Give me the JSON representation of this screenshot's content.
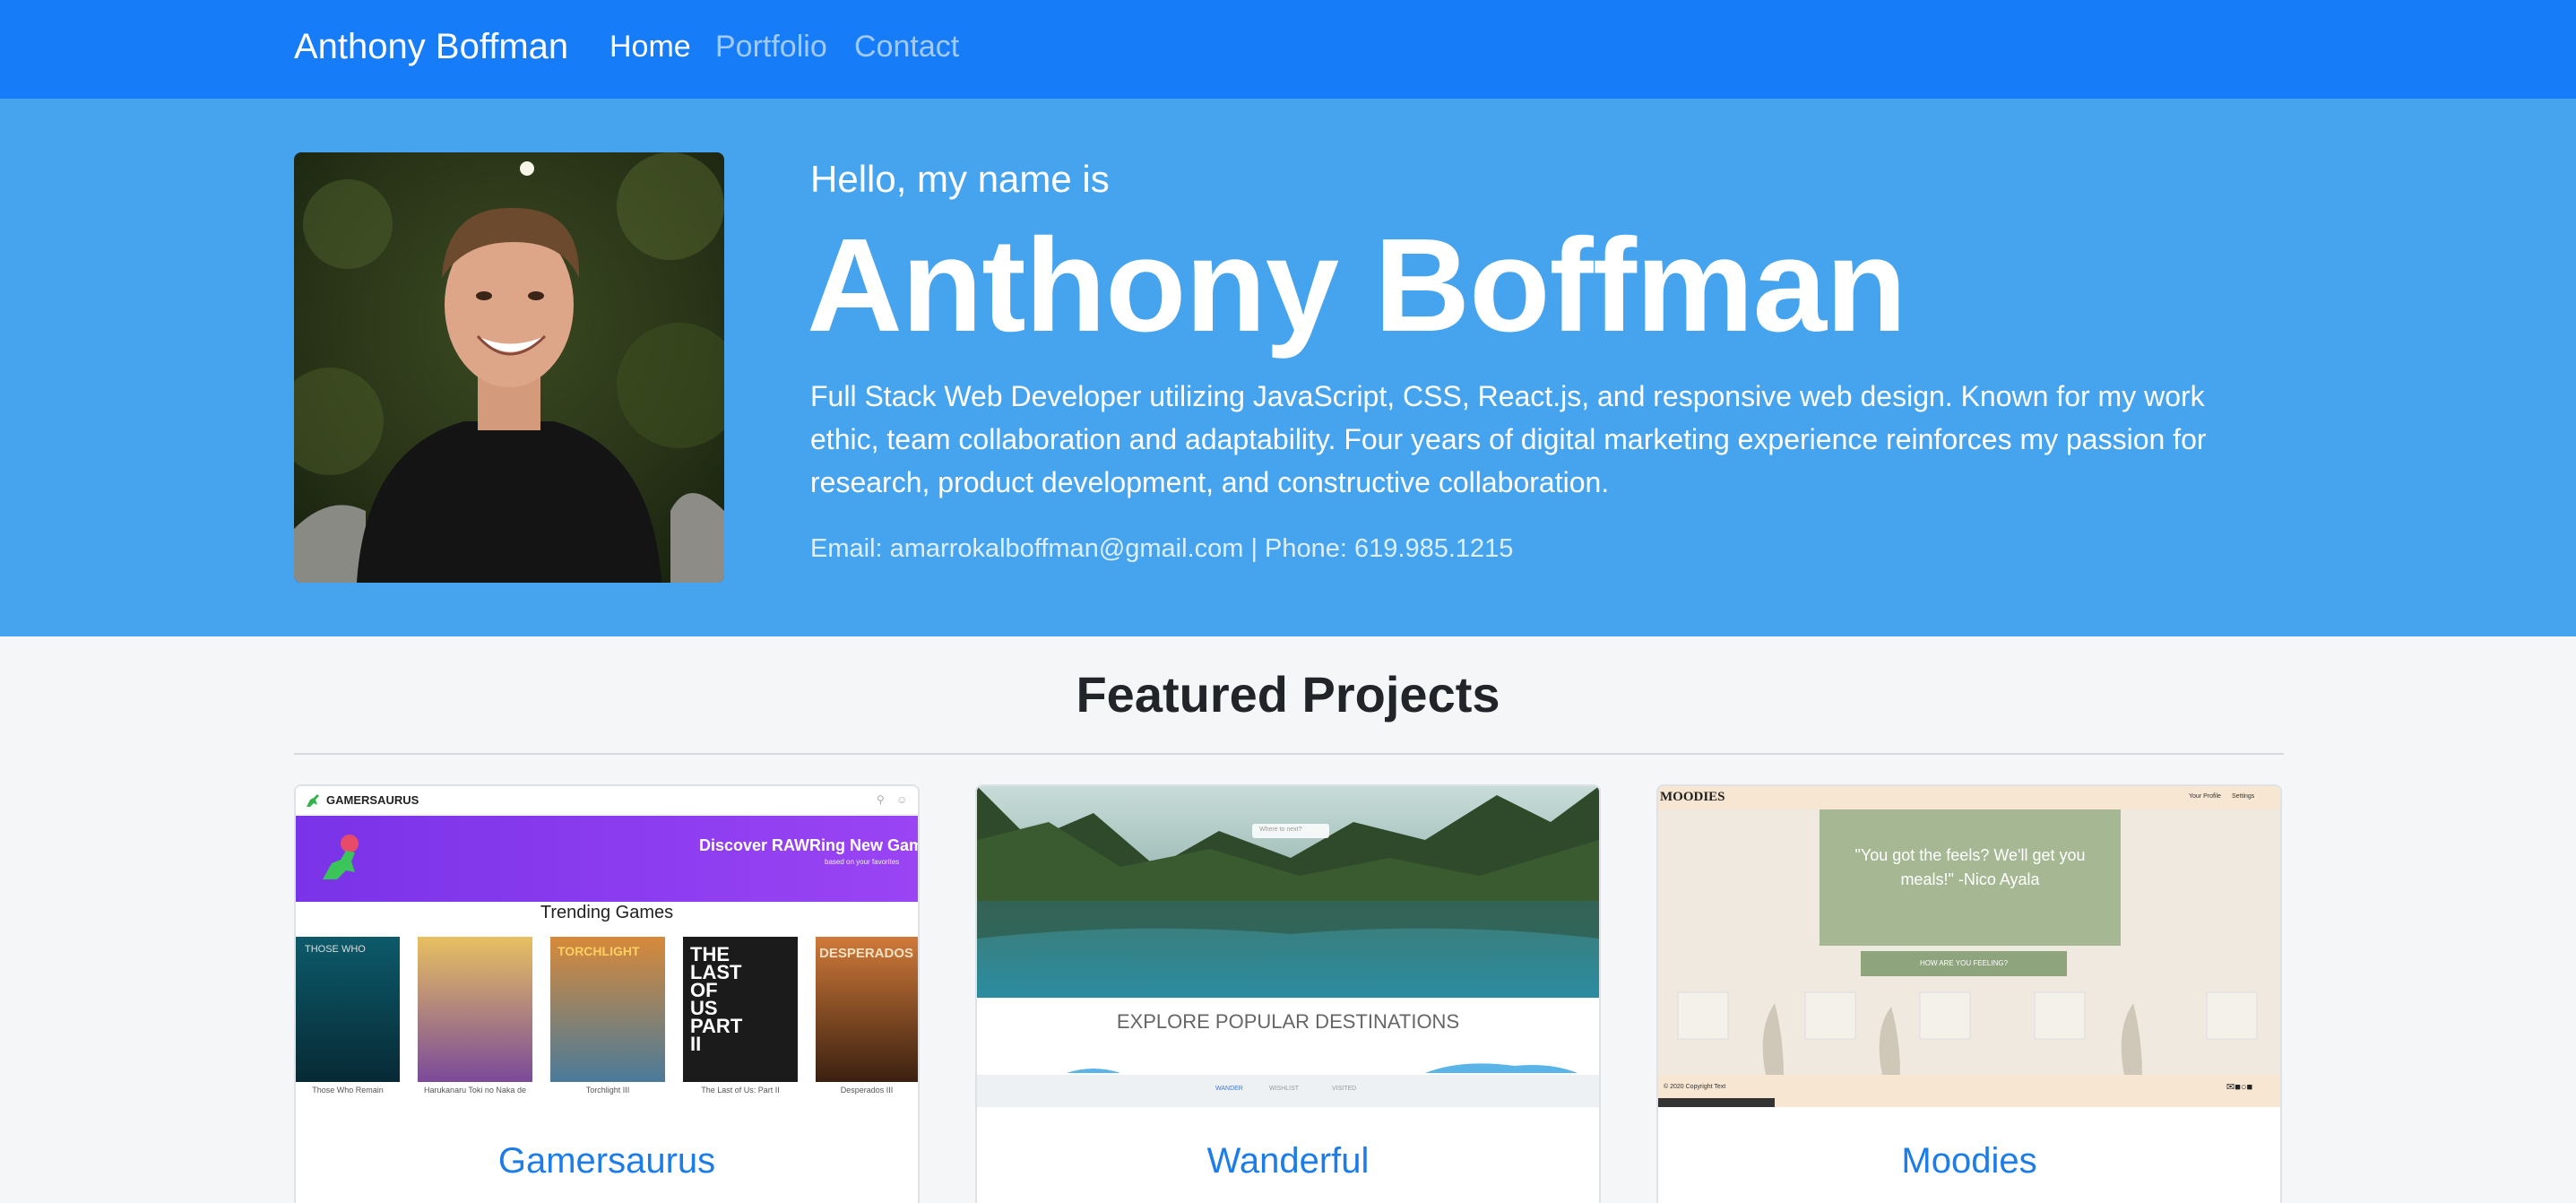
{
  "navbar": {
    "brand": "Anthony Boffman",
    "links": [
      {
        "label": "Home",
        "active": true
      },
      {
        "label": "Portfolio",
        "active": false
      },
      {
        "label": "Contact",
        "active": false
      }
    ]
  },
  "hero": {
    "greeting": "Hello, my name is",
    "name": "Anthony Boffman",
    "bio": "Full Stack Web Developer utilizing JavaScript, CSS, React.js, and responsive web design. Known for my work ethic, team collaboration and adaptability. Four years of digital marketing experience reinforces my passion for research, product development, and constructive collaboration.",
    "contact": "Email: amarrokalboffman@gmail.com | Phone: 619.985.1215"
  },
  "featured": {
    "title": "Featured Projects",
    "projects": [
      {
        "title": "Gamersaurus",
        "preview": {
          "logo": "GAMERSAURUS",
          "banner": "Discover RAWRing New Games",
          "banner_sub": "based on your favorites",
          "section": "Trending Games",
          "games": [
            "Those Who Remain",
            "Harukanaru Toki no Naka de",
            "Torchlight III",
            "The Last of Us: Part II",
            "Desperados III"
          ],
          "covers": [
            "THOSE WHO",
            "",
            "TORCHLIGHT",
            "THE LAST OF US PART II",
            "DESPERADOS"
          ]
        }
      },
      {
        "title": "Wanderful",
        "preview": {
          "search_placeholder": "Where to next?",
          "heading": "EXPLORE POPULAR DESTINATIONS",
          "footer_items": [
            "WANDER",
            "WISHLIST",
            "VISITED"
          ]
        }
      },
      {
        "title": "Moodies",
        "preview": {
          "logo": "MOODIES",
          "nav": [
            "Your Profile",
            "Settings"
          ],
          "quote": "\"You got the feels? We'll get you meals!\" -Nico Ayala",
          "button": "HOW ARE YOU FEELING?",
          "footer": "© 2020 Copyright Text"
        }
      }
    ]
  },
  "colors": {
    "navbar": "#167cf8",
    "hero": "#46a4ef",
    "link": "#1c7ce8",
    "page_bg": "#f5f6f8"
  }
}
